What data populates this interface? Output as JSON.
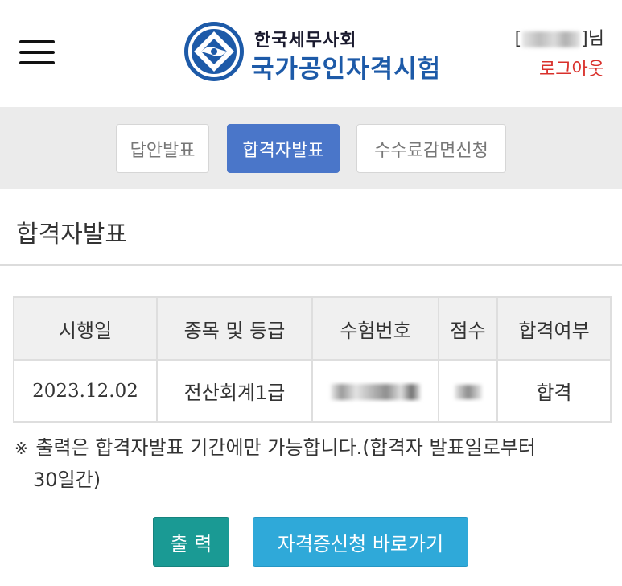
{
  "header": {
    "logo_subtitle": "한국세무사회",
    "logo_title": "국가공인자격시험",
    "user_suffix": "님",
    "logout_label": "로그아웃"
  },
  "tabs": [
    {
      "label": "답안발표",
      "active": false
    },
    {
      "label": "합격자발표",
      "active": true
    },
    {
      "label": "수수료감면신청",
      "active": false
    }
  ],
  "page": {
    "title": "합격자발표"
  },
  "table": {
    "headers": [
      "시행일",
      "종목 및 등급",
      "수험번호",
      "점수",
      "합격여부"
    ],
    "rows": [
      {
        "date": "2023.12.02",
        "subject": "전산회계1급",
        "result": "합격"
      }
    ]
  },
  "note": {
    "mark": "※",
    "line1": "출력은 합격자발표 기간에만 가능합니다.(합격자 발표일로부터",
    "line2": "30일간)"
  },
  "buttons": {
    "print_label": "출 력",
    "cert_label": "자격증신청 바로가기"
  },
  "colors": {
    "brand_blue": "#1d5aa8",
    "active_tab": "#4a76c9",
    "logout_red": "#d9302b",
    "print_button": "#1a9a94",
    "cert_button": "#2fa9d9"
  }
}
